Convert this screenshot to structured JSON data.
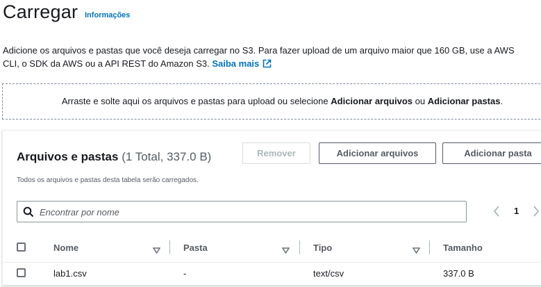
{
  "header": {
    "title": "Carregar",
    "info_link": "Informações"
  },
  "description": {
    "line1": "Adicione os arquivos e pastas que você deseja carregar no S3. Para fazer upload de um arquivo maior que 160 GB, use a AWS",
    "line2": "CLI, o SDK da AWS ou a API REST do Amazon S3.",
    "learn_more": "Saiba mais",
    "learn_more_icon": "external-link-icon"
  },
  "dropzone": {
    "text_before": "Arraste e solte aqui os arquivos e pastas para upload ou selecione",
    "add_files": "Adicionar arquivos",
    "or": "ou",
    "add_folders": "Adicionar pastas",
    "end": "."
  },
  "files_panel": {
    "title": "Arquivos e pastas",
    "count": "(1 Total, 337.0 B)",
    "subtitle": "Todos os arquivos e pastas desta tabela serão carregados.",
    "buttons": {
      "remove": "Remover",
      "add_files": "Adicionar arquivos",
      "add_folder": "Adicionar pasta"
    },
    "search": {
      "placeholder": "Encontrar por nome"
    },
    "pagination": {
      "current_page": "1"
    },
    "columns": [
      "Nome",
      "Pasta",
      "Tipo",
      "Tamanho"
    ],
    "rows": [
      {
        "name": "lab1.csv",
        "folder": "-",
        "type": "text/csv",
        "size": "337.0 B"
      }
    ]
  },
  "colors": {
    "link": "#0073bb",
    "text": "#16191f",
    "secondary_text": "#545b64",
    "border": "#545b64"
  }
}
